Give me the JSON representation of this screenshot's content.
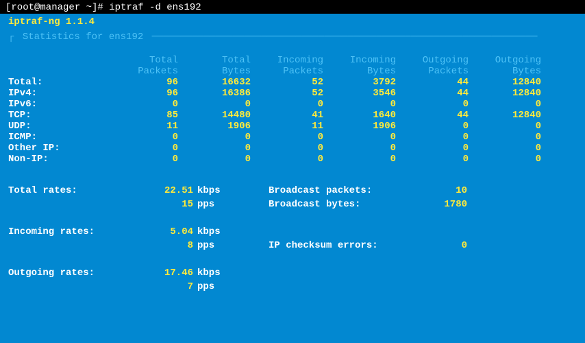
{
  "prompt": {
    "user_host": "[root@manager ~]#",
    "command": "iptraf -d ens192"
  },
  "app": {
    "title": "iptraf-ng 1.1.4",
    "box_label": "Statistics for ens192"
  },
  "headers": {
    "h1a": "Total",
    "h1b": "Packets",
    "h2a": "Total",
    "h2b": "Bytes",
    "h3a": "Incoming",
    "h3b": "Packets",
    "h4a": "Incoming",
    "h4b": "Bytes",
    "h5a": "Outgoing",
    "h5b": "Packets",
    "h6a": "Outgoing",
    "h6b": "Bytes"
  },
  "rows": [
    {
      "label": "Total:",
      "c1": "96",
      "c2": "16632",
      "c3": "52",
      "c4": "3792",
      "c5": "44",
      "c6": "12840"
    },
    {
      "label": "IPv4:",
      "c1": "96",
      "c2": "16386",
      "c3": "52",
      "c4": "3546",
      "c5": "44",
      "c6": "12840"
    },
    {
      "label": "IPv6:",
      "c1": "0",
      "c2": "0",
      "c3": "0",
      "c4": "0",
      "c5": "0",
      "c6": "0"
    },
    {
      "label": "TCP:",
      "c1": "85",
      "c2": "14480",
      "c3": "41",
      "c4": "1640",
      "c5": "44",
      "c6": "12840"
    },
    {
      "label": "UDP:",
      "c1": "11",
      "c2": "1906",
      "c3": "11",
      "c4": "1906",
      "c5": "0",
      "c6": "0"
    },
    {
      "label": "ICMP:",
      "c1": "0",
      "c2": "0",
      "c3": "0",
      "c4": "0",
      "c5": "0",
      "c6": "0"
    },
    {
      "label": "Other IP:",
      "c1": "0",
      "c2": "0",
      "c3": "0",
      "c4": "0",
      "c5": "0",
      "c6": "0"
    },
    {
      "label": "Non-IP:",
      "c1": "0",
      "c2": "0",
      "c3": "0",
      "c4": "0",
      "c5": "0",
      "c6": "0"
    }
  ],
  "rates": {
    "total_label": "Total rates:",
    "total_v1": "22.51",
    "total_u1": "kbps",
    "total_v2": "15",
    "total_u2": "pps",
    "bcast_pkts_label": "Broadcast packets:",
    "bcast_pkts": "10",
    "bcast_bytes_label": "Broadcast bytes:",
    "bcast_bytes": "1780",
    "in_label": "Incoming rates:",
    "in_v1": "5.04",
    "in_u1": "kbps",
    "in_v2": "8",
    "in_u2": "pps",
    "chk_label": "IP checksum errors:",
    "chk": "0",
    "out_label": "Outgoing rates:",
    "out_v1": "17.46",
    "out_u1": "kbps",
    "out_v2": "7",
    "out_u2": "pps"
  }
}
